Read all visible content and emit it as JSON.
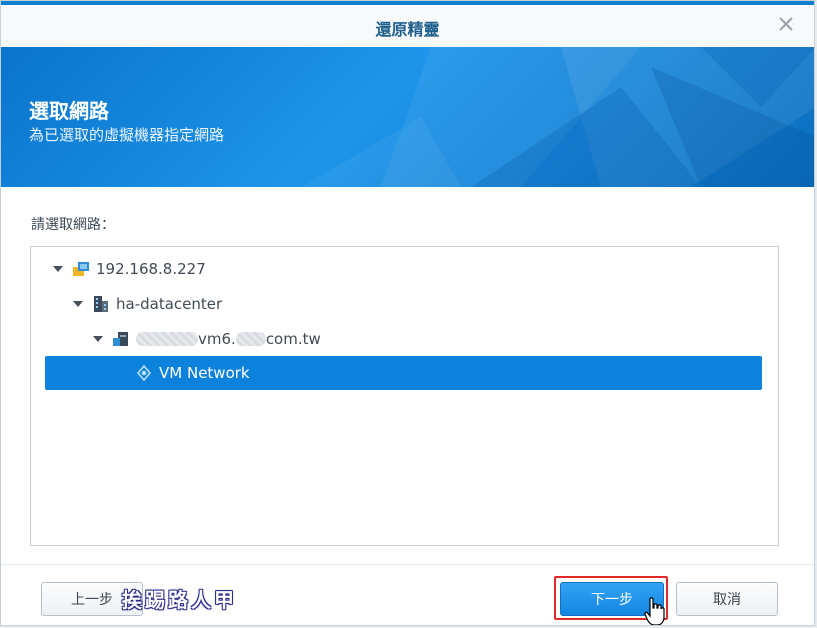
{
  "window": {
    "title": "還原精靈",
    "accent_color": "#0f7fd0"
  },
  "banner": {
    "title": "選取網路",
    "subtitle": "為已選取的虛擬機器指定網路"
  },
  "prompt": "請選取網路：",
  "tree": {
    "nodes": [
      {
        "label": "192.168.8.227",
        "icon": "host-icon",
        "expanded": true,
        "level": 0
      },
      {
        "label": "ha-datacenter",
        "icon": "datacenter-icon",
        "expanded": true,
        "level": 1
      },
      {
        "label_visible": "vm6.",
        "label_suffix": "com.tw",
        "icon": "server-icon",
        "expanded": true,
        "level": 2
      },
      {
        "label": "VM Network",
        "icon": "network-icon",
        "selected": true,
        "level": 3
      }
    ]
  },
  "buttons": {
    "back": "上一步",
    "next": "下一步",
    "cancel": "取消"
  },
  "watermark": "挨踢路人甲",
  "colors": {
    "selected_row": "#0d82dc",
    "primary_button": "#1286e3",
    "highlight_box": "#e02a2a"
  }
}
